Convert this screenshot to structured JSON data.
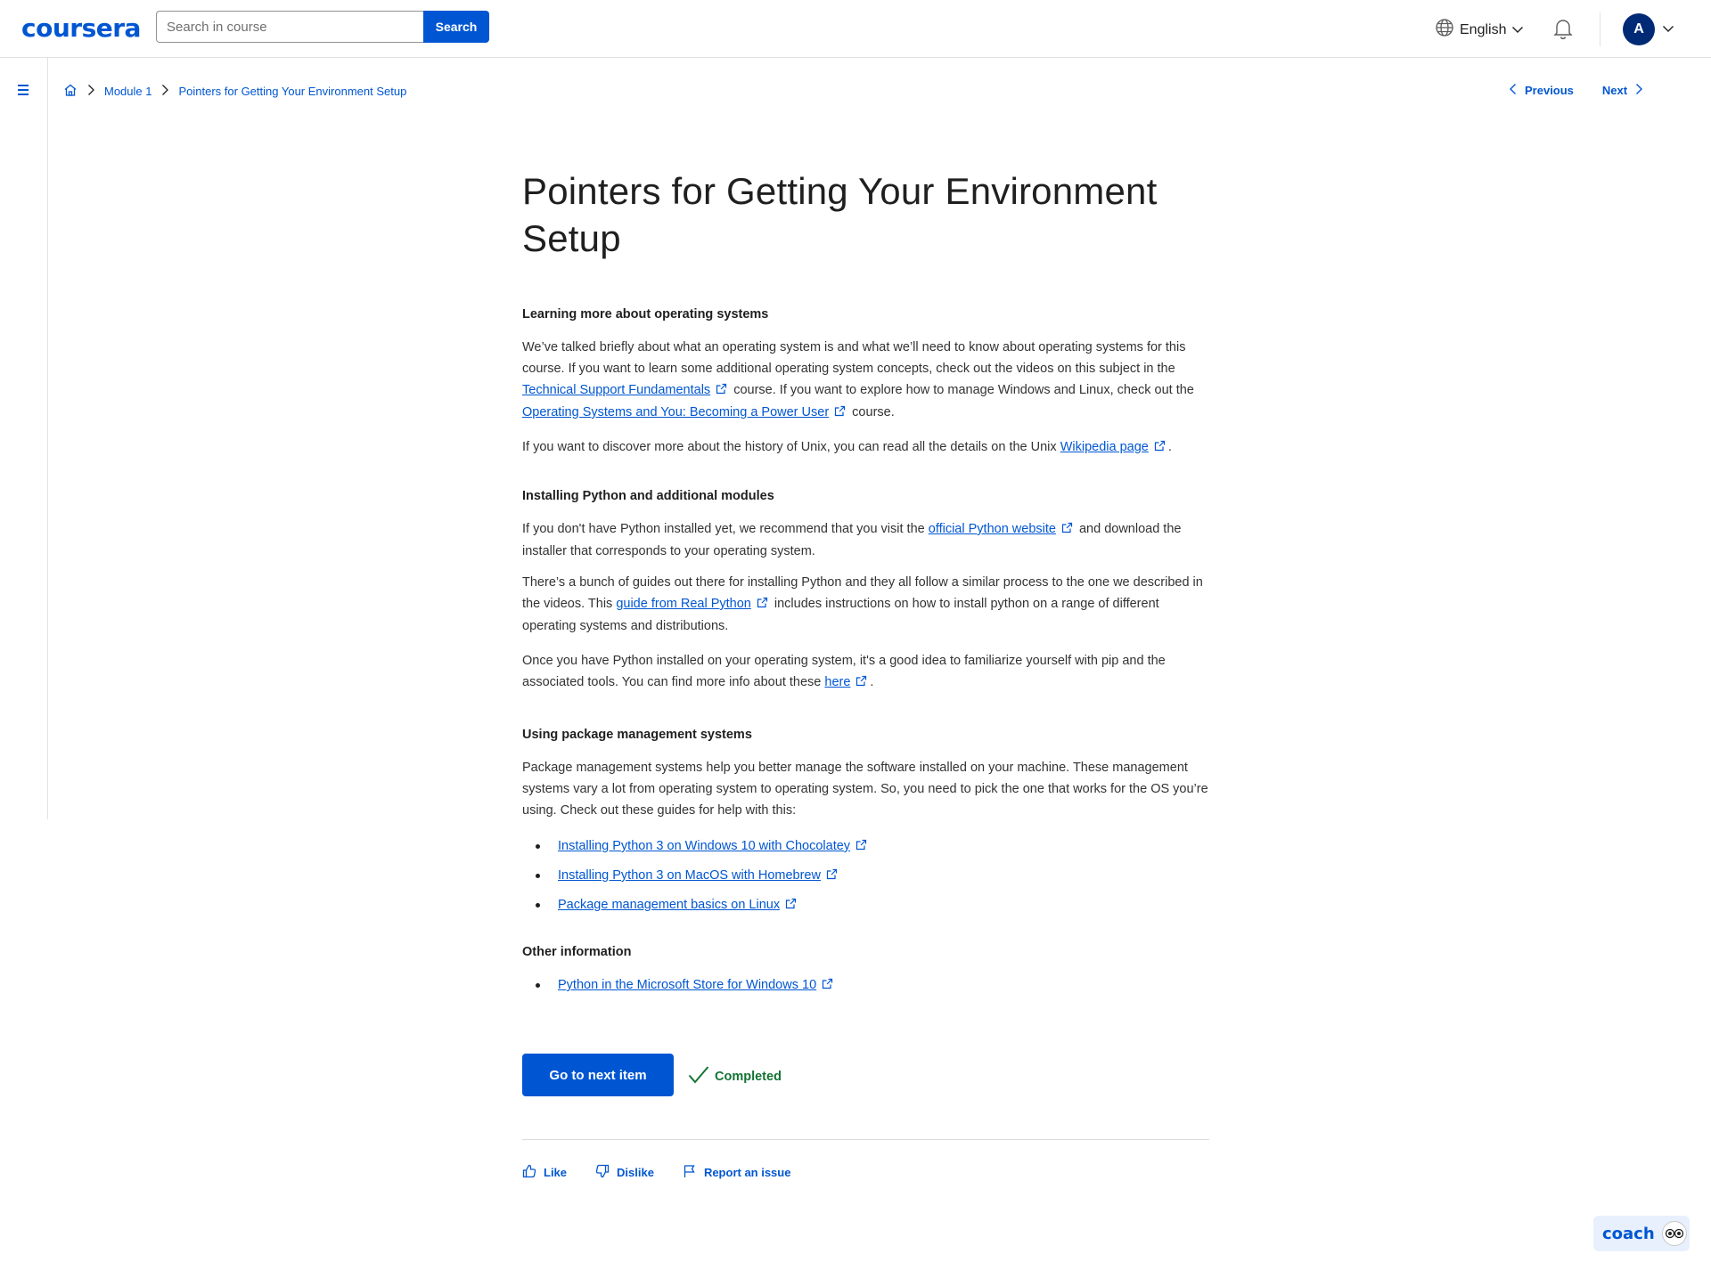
{
  "header": {
    "logo": "coursera",
    "search_placeholder": "Search in course",
    "search_button": "Search",
    "language": "English",
    "avatar_initial": "A"
  },
  "breadcrumb": {
    "module": "Module 1",
    "current": "Pointers for Getting Your Environment Setup"
  },
  "nav": {
    "previous": "Previous",
    "next": "Next"
  },
  "page": {
    "title": "Pointers for Getting Your Environment Setup",
    "sections": {
      "os": {
        "heading": "Learning more about operating systems",
        "p1_a": "We’ve talked briefly about what an operating system is and what we’ll need to know about operating systems for this course. If you want to learn some additional operating system concepts, check out the videos on this subject in the ",
        "p1_link1": "Technical Support Fundamentals",
        "p1_b": " course. If you want to explore how to manage Windows and Linux, check out the ",
        "p1_link2": "Operating Systems and You: Becoming a Power User",
        "p1_c": " course.",
        "p2_a": "If you want to discover more about the history of Unix, you can read all the details on the Unix ",
        "p2_link": "Wikipedia page",
        "p2_b": "."
      },
      "python": {
        "heading": "Installing Python and additional modules",
        "p1_a": "If you don't have Python installed yet, we recommend that you visit the ",
        "p1_link": "official Python website",
        "p1_b": " and download the installer that corresponds to your operating system.",
        "p2_a": " There’s a bunch of guides out there for installing Python and they all follow a similar process to the one we described in the videos. This ",
        "p2_link": "guide from Real Python",
        "p2_b": " includes instructions on how to install python on a range of different operating systems and distributions.",
        "p3_a": " Once you have Python installed on your operating system, it's a good idea to familiarize yourself with pip and the associated tools. You can find more info about these ",
        "p3_link": "here",
        "p3_b": "."
      },
      "packages": {
        "heading": "Using package management systems",
        "p1": "Package management systems help you better manage the software installed on your machine. These management systems vary a lot from operating system to operating system. So, you need to pick the one that works for the OS you’re using. Check out these guides for help with this:",
        "links": [
          "Installing Python 3 on Windows 10 with Chocolatey",
          "Installing Python 3 on MacOS with Homebrew",
          "Package management basics on Linux"
        ]
      },
      "other": {
        "heading": "Other information",
        "links": [
          "Python in the Microsoft Store for Windows 10"
        ]
      }
    },
    "next_item_button": "Go to next item",
    "completed_label": "Completed",
    "feedback": {
      "like": "Like",
      "dislike": "Dislike",
      "report": "Report an issue"
    }
  },
  "coach": {
    "label": "coach"
  },
  "colors": {
    "brand": "#0056d2",
    "completed": "#137333",
    "avatar_bg": "#002a75"
  },
  "icons": [
    "globe-icon",
    "chevron-down-icon",
    "bell-icon",
    "menu-icon",
    "home-icon",
    "chevron-right-icon",
    "chevron-left-icon",
    "external-link-icon",
    "check-icon",
    "thumbs-up-icon",
    "thumbs-down-icon",
    "flag-icon",
    "coach-icon"
  ]
}
